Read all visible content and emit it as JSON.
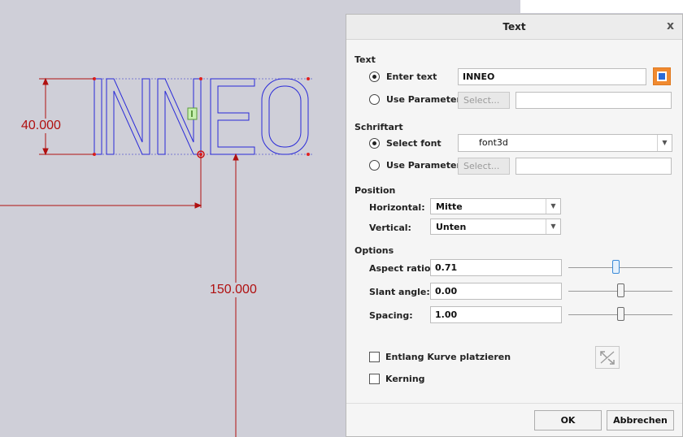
{
  "canvas": {
    "dimension_height": "40.000",
    "dimension_distance": "150.000",
    "sketch_text": "INNEO"
  },
  "dialog": {
    "title": "Text",
    "close_label": "x",
    "text_section": {
      "heading": "Text",
      "enter_text_label": "Enter text",
      "enter_text_value": "INNEO",
      "use_parameter_label": "Use Parameter",
      "select_button": "Select...",
      "selected_mode": "enter-text"
    },
    "font_section": {
      "heading": "Schriftart",
      "select_font_label": "Select font",
      "font_value": "font3d",
      "use_parameter_label": "Use Parameter",
      "select_button": "Select...",
      "selected_mode": "select-font"
    },
    "position_section": {
      "heading": "Position",
      "horizontal_label": "Horizontal:",
      "horizontal_value": "Mitte",
      "vertical_label": "Vertical:",
      "vertical_value": "Unten"
    },
    "options_section": {
      "heading": "Options",
      "aspect_ratio_label": "Aspect ratio:",
      "aspect_ratio_value": "0.71",
      "aspect_ratio_slider_fraction": 0.45,
      "slant_angle_label": "Slant angle:",
      "slant_angle_value": "0.00",
      "slant_angle_slider_fraction": 0.5,
      "spacing_label": "Spacing:",
      "spacing_value": "1.00",
      "spacing_slider_fraction": 0.5,
      "along_curve_label": "Entlang Kurve platzieren",
      "along_curve_checked": false,
      "kerning_label": "Kerning",
      "kerning_checked": false
    },
    "buttons": {
      "ok": "OK",
      "cancel": "Abbrechen"
    },
    "icons": {
      "text_color_icon": "orange-blue-square-icon",
      "flip_icon": "flip-diagonal-arrows-icon",
      "dropdown_icon": "chevron-down-icon",
      "close_icon": "close-icon"
    },
    "colors": {
      "dimension": "#b01010",
      "sketch": "#2a2ad8",
      "accent_slider": "#3a8ad8"
    }
  }
}
